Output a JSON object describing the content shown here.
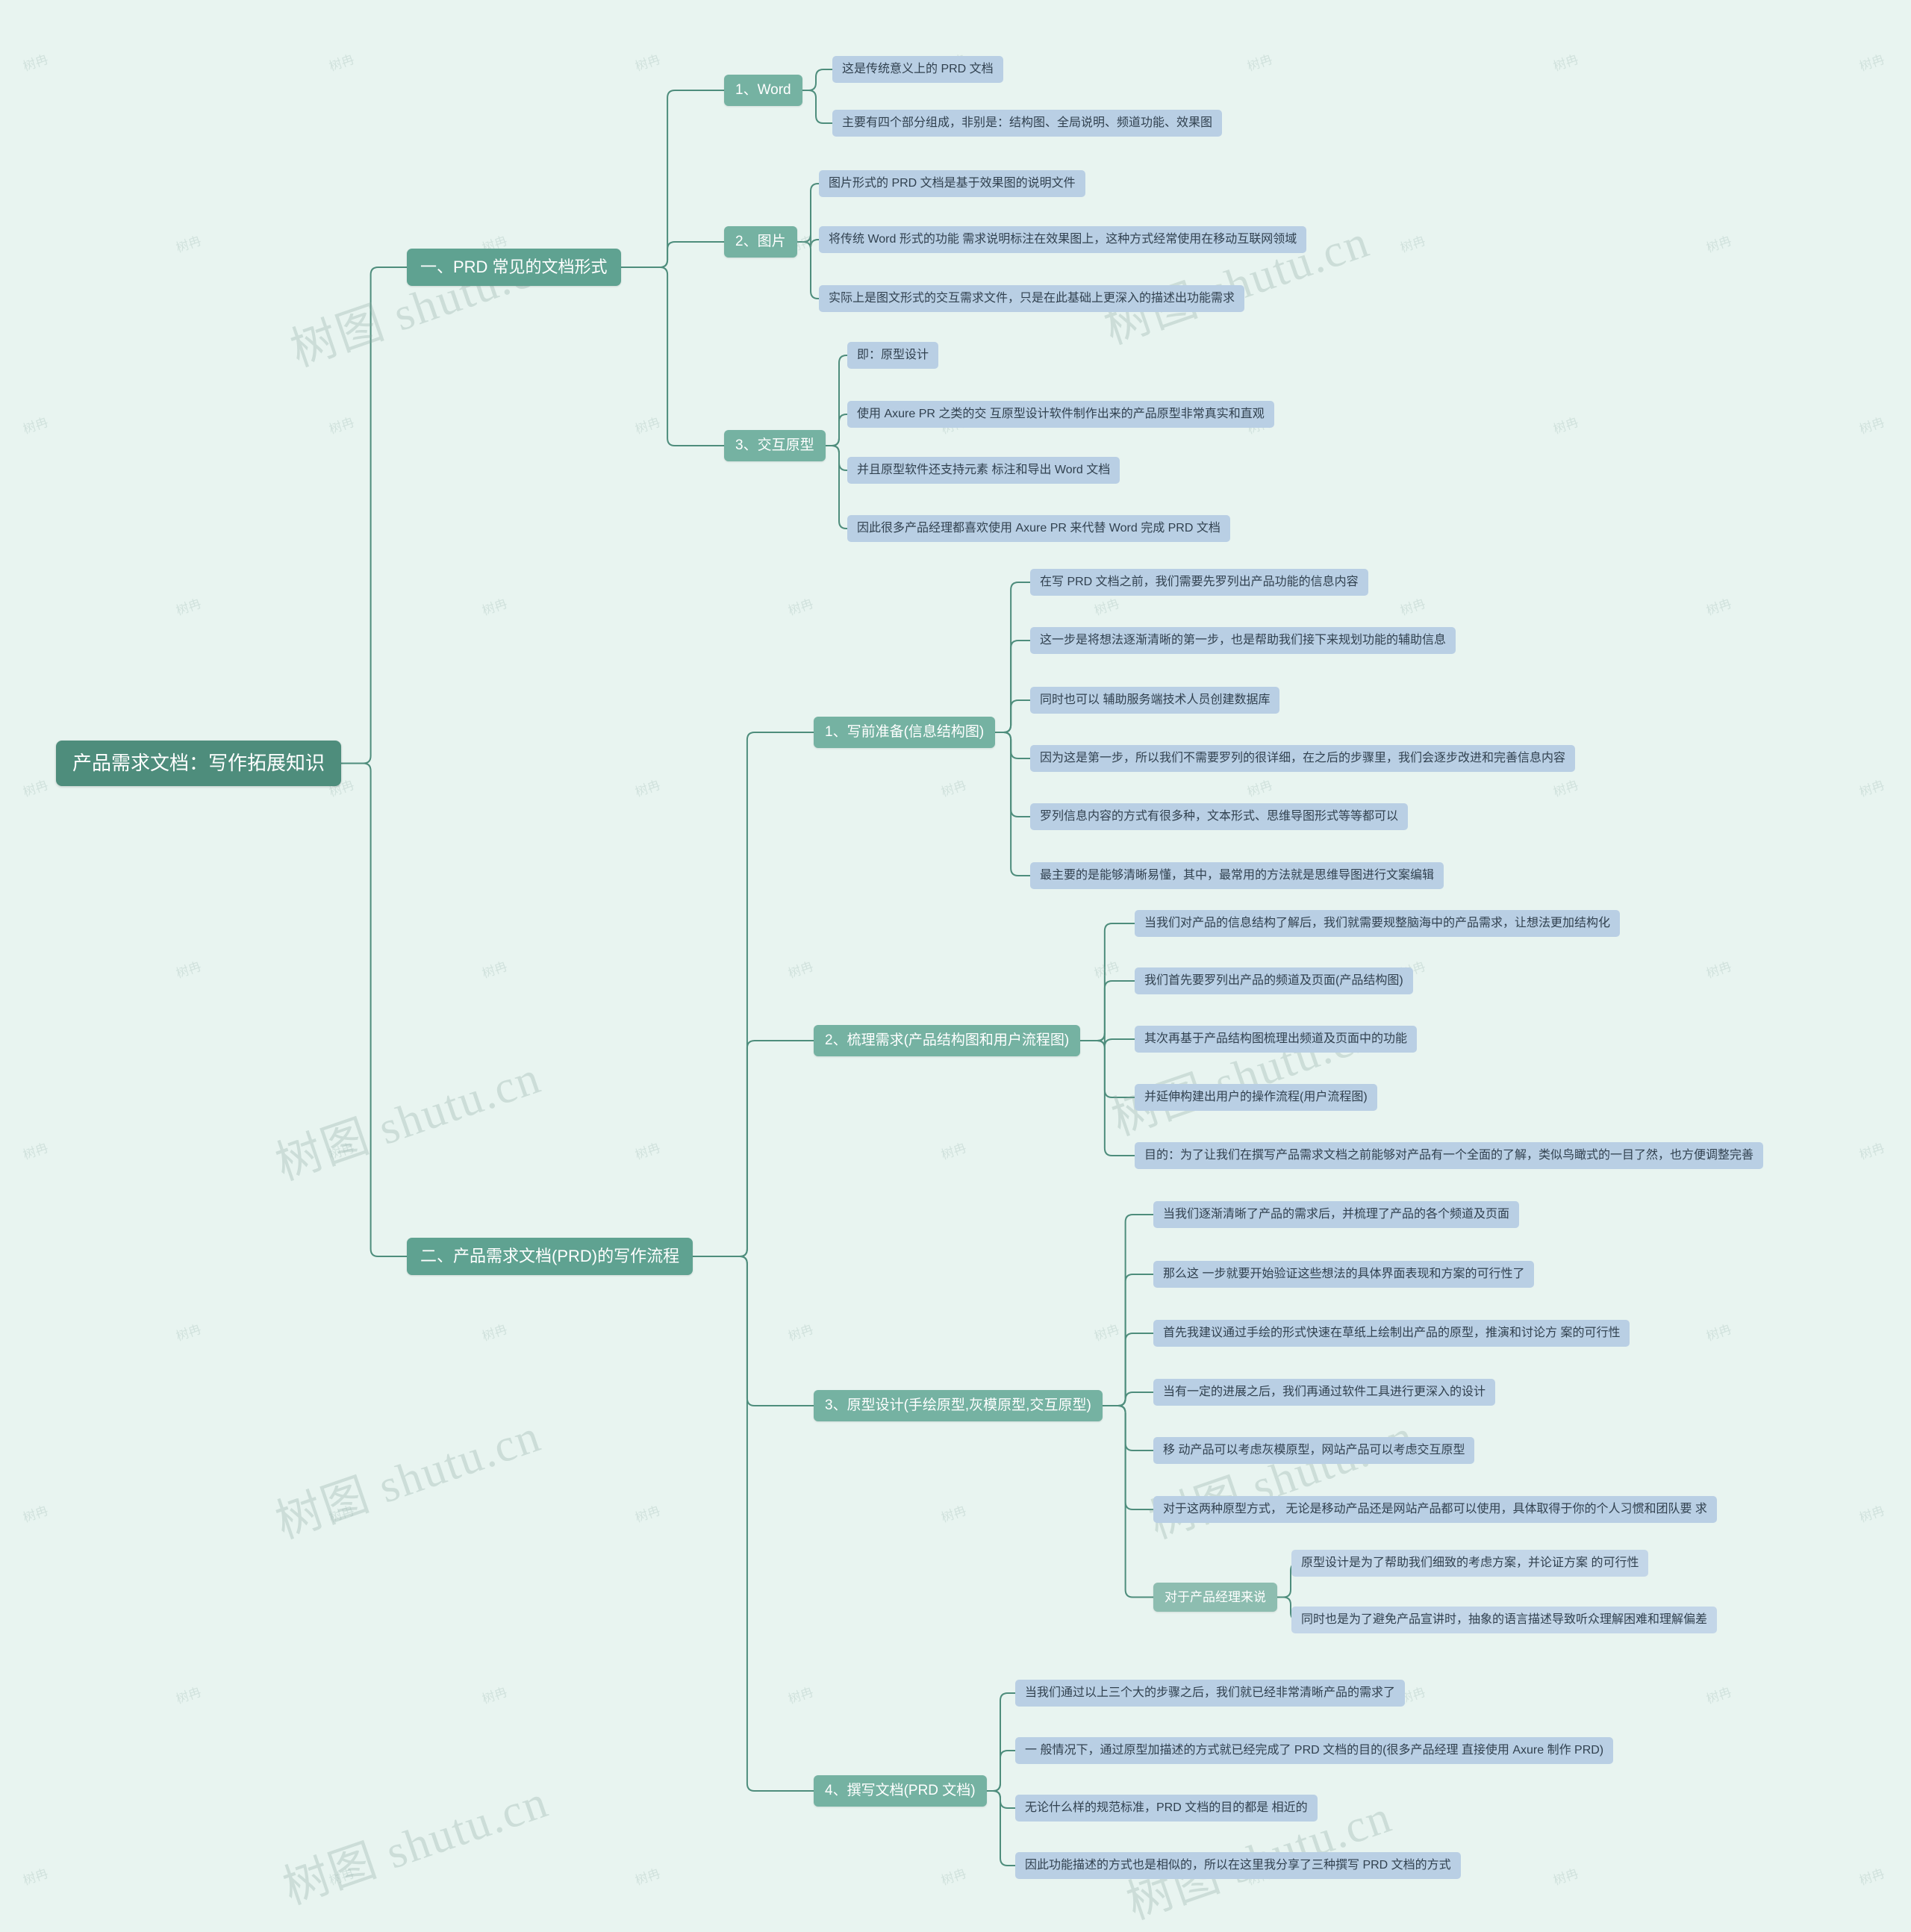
{
  "title": "产品需求文档：写作拓展知识",
  "colors": {
    "background": "#e8f4f0",
    "root": "#4e8d7c",
    "level1": "#5fa291",
    "level2": "#75b2a2",
    "leaf": "#b9cfe4",
    "link": "#4e8d7c"
  },
  "watermarks": {
    "large": "树图 shutu.cn",
    "small": "树冉"
  },
  "root": {
    "label": "产品需求文档：写作拓展知识"
  },
  "branches": [
    {
      "label": "一、PRD 常见的文档形式",
      "children": [
        {
          "label": "1、Word",
          "items": [
            "这是传统意义上的 PRD 文档",
            "主要有四个部分组成，非别是：结构图、全局说明、频道功能、效果图"
          ]
        },
        {
          "label": "2、图片",
          "items": [
            "图片形式的 PRD 文档是基于效果图的说明文件",
            "将传统 Word 形式的功能 需求说明标注在效果图上，这种方式经常使用在移动互联网领域",
            "实际上是图文形式的交互需求文件，只是在此基础上更深入的描述出功能需求"
          ]
        },
        {
          "label": "3、交互原型",
          "items": [
            "即：原型设计",
            "使用 Axure PR 之类的交 互原型设计软件制作出来的产品原型非常真实和直观",
            "并且原型软件还支持元素 标注和导出 Word 文档",
            "因此很多产品经理都喜欢使用 Axure PR 来代替 Word 完成 PRD 文档"
          ]
        }
      ]
    },
    {
      "label": "二、产品需求文档(PRD)的写作流程",
      "children": [
        {
          "label": "1、写前准备(信息结构图)",
          "items": [
            "在写 PRD 文档之前，我们需要先罗列出产品功能的信息内容",
            "这一步是将想法逐渐清晰的第一步，也是帮助我们接下来规划功能的辅助信息",
            "同时也可以 辅助服务端技术人员创建数据库",
            "因为这是第一步，所以我们不需要罗列的很详细，在之后的步骤里，我们会逐步改进和完善信息内容",
            "罗列信息内容的方式有很多种，文本形式、思维导图形式等等都可以",
            "最主要的是能够清晰易懂，其中，最常用的方法就是思维导图进行文案编辑"
          ]
        },
        {
          "label": "2、梳理需求(产品结构图和用户流程图)",
          "items": [
            "当我们对产品的信息结构了解后，我们就需要规整脑海中的产品需求，让想法更加结构化",
            "我们首先要罗列出产品的频道及页面(产品结构图)",
            "其次再基于产品结构图梳理出频道及页面中的功能",
            "并延伸构建出用户的操作流程(用户流程图)",
            "目的：为了让我们在撰写产品需求文档之前能够对产品有一个全面的了解，类似鸟瞰式的一目了然，也方便调整完善"
          ]
        },
        {
          "label": "3、原型设计(手绘原型,灰模原型,交互原型)",
          "items": [
            "当我们逐渐清晰了产品的需求后，并梳理了产品的各个频道及页面",
            "那么这 一步就要开始验证这些想法的具体界面表现和方案的可行性了",
            "首先我建议通过手绘的形式快速在草纸上绘制出产品的原型，推演和讨论方 案的可行性",
            "当有一定的进展之后，我们再通过软件工具进行更深入的设计",
            "移 动产品可以考虑灰模原型，网站产品可以考虑交互原型",
            "对于这两种原型方式， 无论是移动产品还是网站产品都可以使用，具体取得于你的个人习惯和团队要 求"
          ],
          "group": {
            "label": "对于产品经理来说",
            "items": [
              "原型设计是为了帮助我们细致的考虑方案，并论证方案 的可行性",
              "同时也是为了避免产品宣讲时，抽象的语言描述导致听众理解困难和理解偏差"
            ]
          }
        },
        {
          "label": "4、撰写文档(PRD 文档)",
          "items": [
            "当我们通过以上三个大的步骤之后，我们就已经非常清晰产品的需求了",
            "一 般情况下，通过原型加描述的方式就已经完成了 PRD 文档的目的(很多产品经理 直接使用 Axure 制作 PRD)",
            "无论什么样的规范标准，PRD 文档的目的都是 相近的",
            "因此功能描述的方式也是相似的，所以在这里我分享了三种撰写 PRD 文档的方式"
          ]
        }
      ]
    }
  ]
}
